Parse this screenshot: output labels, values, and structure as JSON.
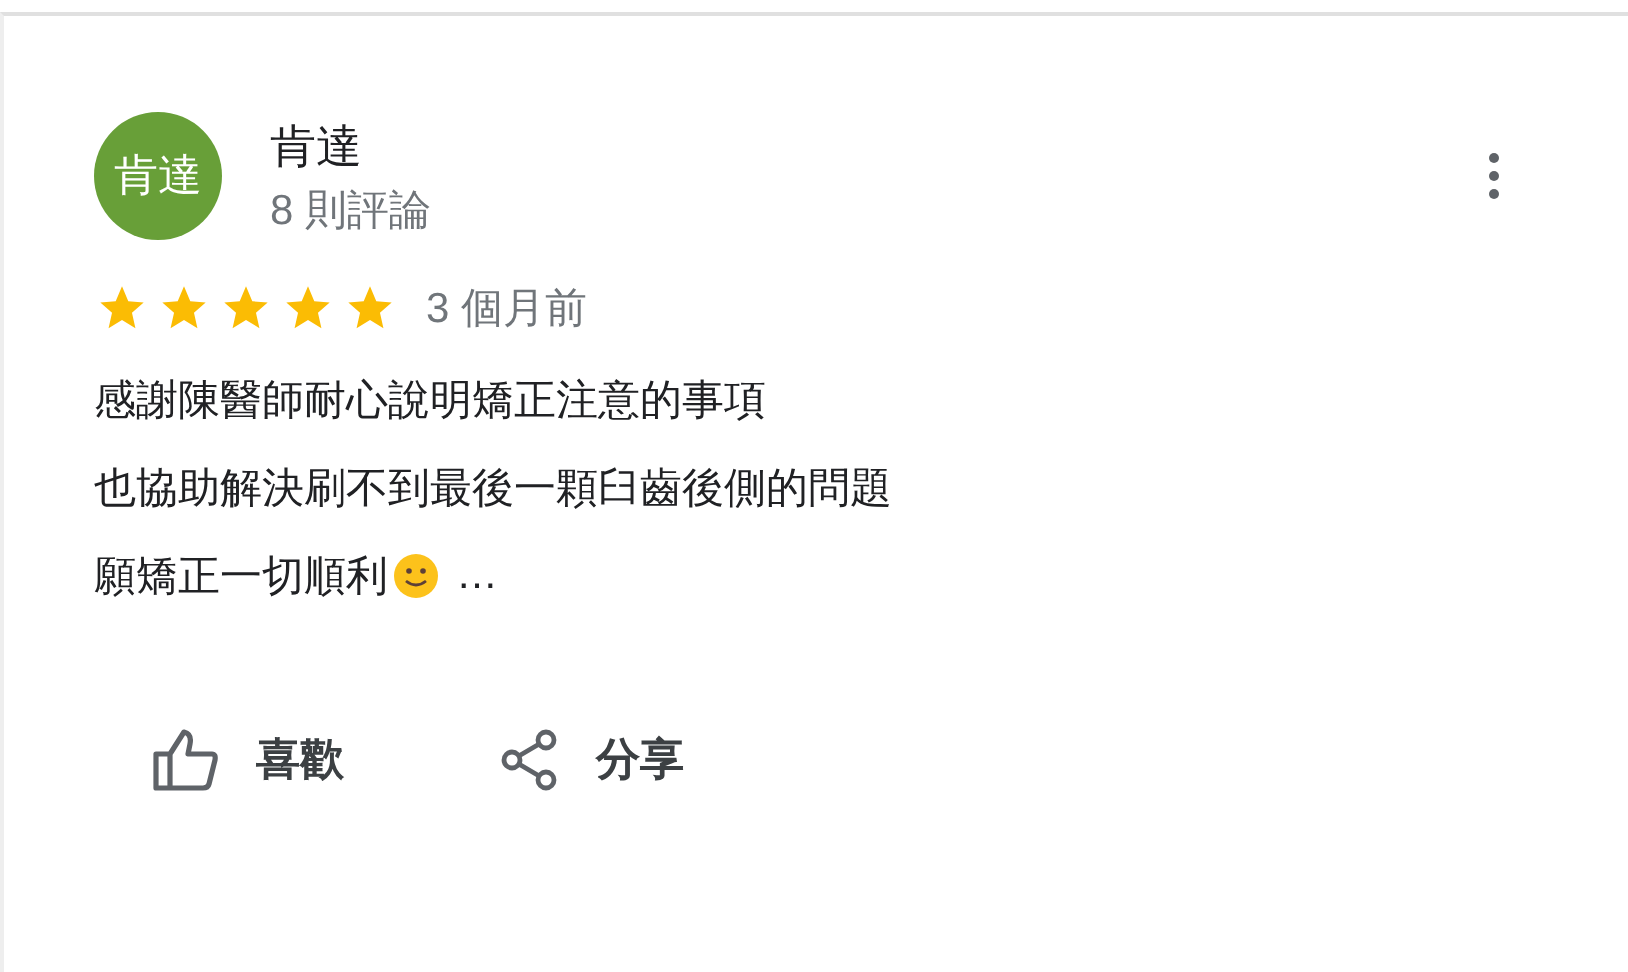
{
  "review": {
    "avatar_text": "肯達",
    "author": "肯達",
    "review_count": "8 則評論",
    "stars": 5,
    "time": "3 個月前",
    "body_lines": [
      "感謝陳醫師耐心說明矯正注意的事項",
      "也協助解決刷不到最後一顆臼齒後側的問題",
      "願矯正一切順利"
    ],
    "more_marker": "…"
  },
  "actions": [
    {
      "kind": "like",
      "label": "喜歡"
    },
    {
      "kind": "share",
      "label": "分享"
    }
  ]
}
